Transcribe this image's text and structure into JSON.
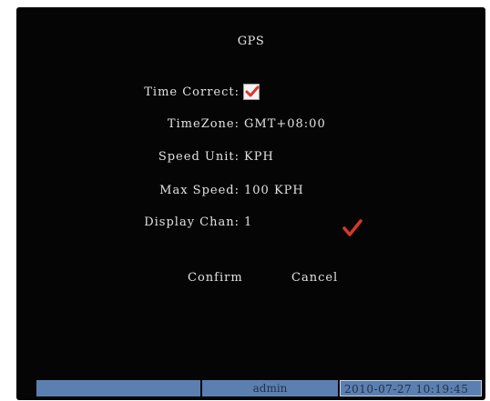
{
  "dialog": {
    "title": "GPS"
  },
  "fields": {
    "time_correct": {
      "label": "Time Correct:",
      "checked": true
    },
    "timezone": {
      "label": "TimeZone:",
      "value": "GMT+08:00"
    },
    "speed_unit": {
      "label": "Speed Unit:",
      "value": "KPH"
    },
    "max_speed": {
      "label": "Max Speed:",
      "value": "100 KPH"
    },
    "display_chan": {
      "label": "Display Chan:",
      "value": "1"
    }
  },
  "buttons": {
    "confirm": "Confirm",
    "cancel": "Cancel"
  },
  "statusbar": {
    "user": "admin",
    "datetime": "2010-07-27 10:19:45"
  },
  "colors": {
    "background": "#050505",
    "check_red": "#d9362b",
    "status_blue": "#5b7fb0"
  }
}
